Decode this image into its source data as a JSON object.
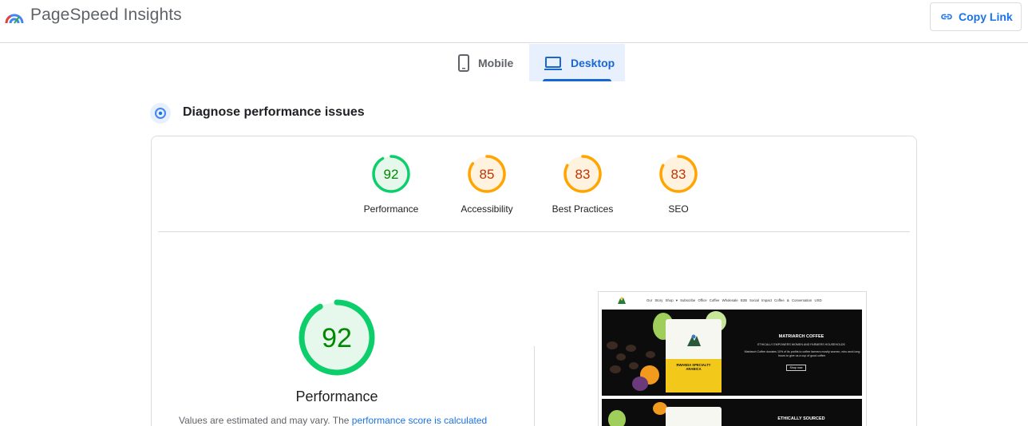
{
  "header": {
    "app_title": "PageSpeed Insights",
    "copy_link_label": "Copy Link"
  },
  "tabs": [
    {
      "label": "Mobile",
      "selected": false,
      "icon": "phone-icon"
    },
    {
      "label": "Desktop",
      "selected": true,
      "icon": "laptop-icon"
    }
  ],
  "section": {
    "title": "Diagnose performance issues",
    "icon": "gauge-icon"
  },
  "scores": [
    {
      "value": "92",
      "label": "Performance",
      "fraction": 0.92,
      "color": "#0cce6b",
      "text_color": "#008800",
      "fill": "#e6f7ec"
    },
    {
      "value": "85",
      "label": "Accessibility",
      "fraction": 0.85,
      "color": "#ffa400",
      "text_color": "#c33300",
      "fill": "#fff3e0"
    },
    {
      "value": "83",
      "label": "Best Practices",
      "fraction": 0.83,
      "color": "#ffa400",
      "text_color": "#c33300",
      "fill": "#fff3e0"
    },
    {
      "value": "83",
      "label": "SEO",
      "fraction": 0.83,
      "color": "#ffa400",
      "text_color": "#c33300",
      "fill": "#fff3e0"
    }
  ],
  "performance": {
    "score": "92",
    "fraction": 0.92,
    "label": "Performance",
    "note_prefix": "Values are estimated and may vary. The ",
    "note_link": "performance score is calculated"
  },
  "thumbnail": {
    "menu": "Our Story  Shop ▾  Subscribe  Office Coffee  Wholesale B2B  Social Impact  Coffee & Conversation      USD",
    "hero_title": "MATRIARCH COFFEE",
    "hero_subtitle": "ETHICALLY EMPOWERS WOMEN AND FARMERS HOUSEHOLDS",
    "hero_body": "Matriarch Coffee donates 10% of its profits to coffee farmers mostly women, who work long hours to give us a cup of good coffee.",
    "hero_button": "Shop now",
    "bag_text": "RWANDA SPECIALTY ARABICA",
    "section2_title": "ETHICALLY SOURCED"
  },
  "colors": {
    "accent": "#1a73e8",
    "pass": "#0cce6b",
    "average": "#ffa400"
  }
}
